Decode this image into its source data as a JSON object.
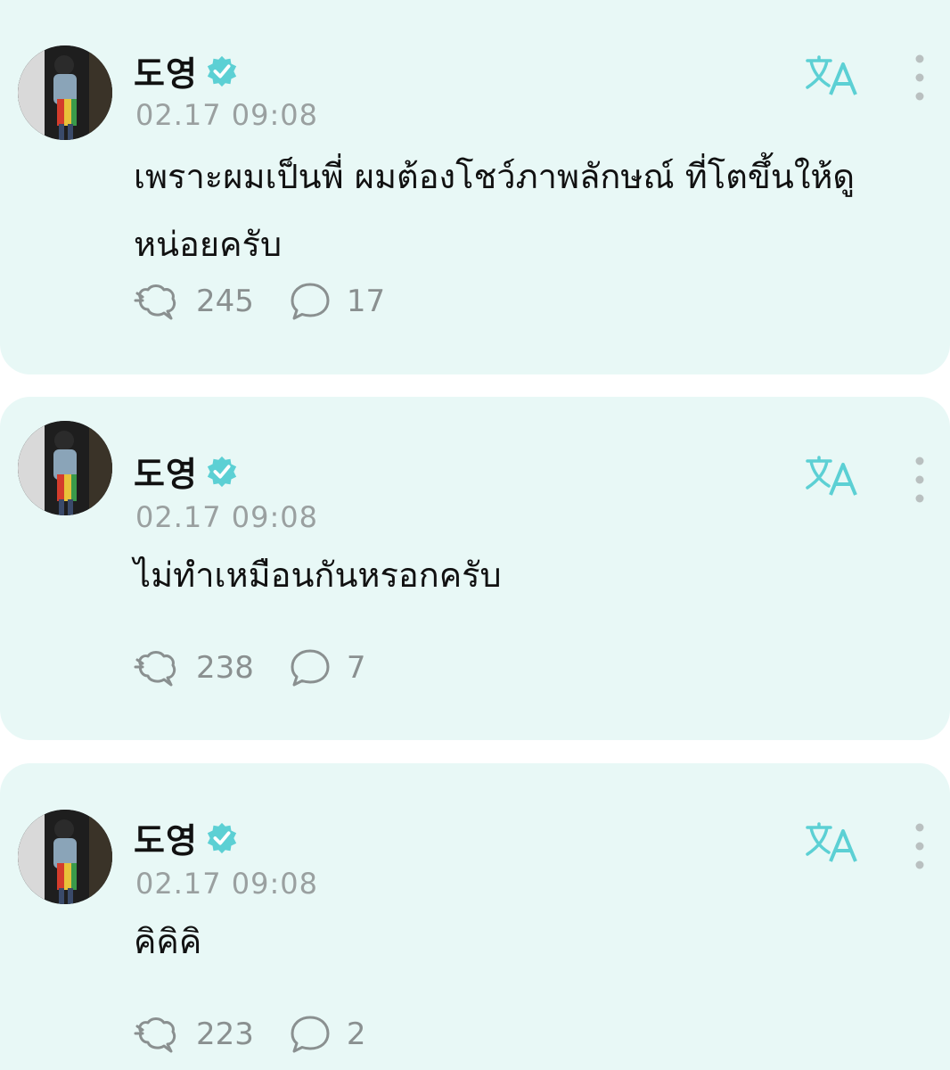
{
  "posts": [
    {
      "author": "도영",
      "timestamp": "02.17 09:08",
      "text": "เพราะผมเป็นพี่ ผมต้องโชว์ภาพลักษณ์ ที่โตขึ้นให้ดูหน่อยครับ",
      "likes": "245",
      "comments": "17"
    },
    {
      "author": "도영",
      "timestamp": "02.17 09:08",
      "text": "ไม่ทำเหมือนกันหรอกครับ",
      "likes": "238",
      "comments": "7"
    },
    {
      "author": "도영",
      "timestamp": "02.17 09:08",
      "text": "คิคิคิ",
      "likes": "223",
      "comments": "2"
    }
  ],
  "icons": {
    "verified": "verified-badge-icon",
    "translate": "translate-icon",
    "more": "more-vertical-icon",
    "like": "like-icon",
    "comment": "comment-bubble-icon"
  },
  "colors": {
    "card_background": "#e8f8f6",
    "accent": "#5cd0d4",
    "muted_text": "#9aa0a0",
    "icon_gray": "#8a9090"
  }
}
